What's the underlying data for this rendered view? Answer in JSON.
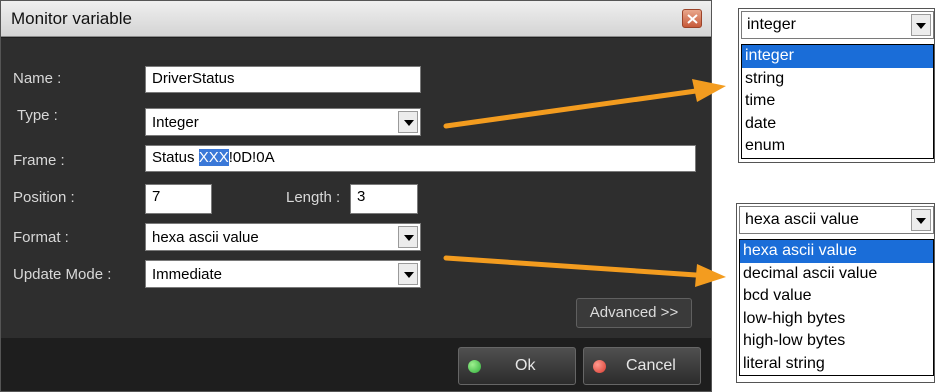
{
  "dialog": {
    "title": "Monitor variable",
    "fields": {
      "name": {
        "label": "Name :",
        "value": "DriverStatus"
      },
      "type": {
        "label": "Type :",
        "value": "Integer"
      },
      "frame": {
        "label": "Frame :",
        "value_prefix": "Status ",
        "value_selected": "XXX",
        "value_suffix": "!0D!0A"
      },
      "position": {
        "label": "Position :",
        "value": "7"
      },
      "length": {
        "label": "Length :",
        "value": "3"
      },
      "format": {
        "label": "Format :",
        "value": "hexa ascii value"
      },
      "update_mode": {
        "label": "Update Mode :",
        "value": "Immediate"
      }
    },
    "advanced_label": "Advanced >>",
    "ok_label": "Ok",
    "cancel_label": "Cancel"
  },
  "type_popup": {
    "selected": "integer",
    "options": [
      "integer",
      "string",
      "time",
      "date",
      "enum"
    ]
  },
  "format_popup": {
    "selected": "hexa ascii value",
    "options": [
      "hexa ascii value",
      "decimal ascii value",
      "bcd value",
      "low-high bytes",
      "high-low bytes",
      "literal string"
    ]
  },
  "colors": {
    "dialog_bg": "#2e2e2e",
    "selection": "#1a6dd8",
    "arrow": "#f39c1f",
    "ok_dot": "#2fae3a",
    "cancel_dot": "#d93a2f"
  },
  "icons": {
    "close": "close-icon",
    "dropdown": "chevron-down-icon",
    "ok": "green-dot-icon",
    "cancel": "red-dot-icon",
    "annotation": "arrow-icon"
  }
}
